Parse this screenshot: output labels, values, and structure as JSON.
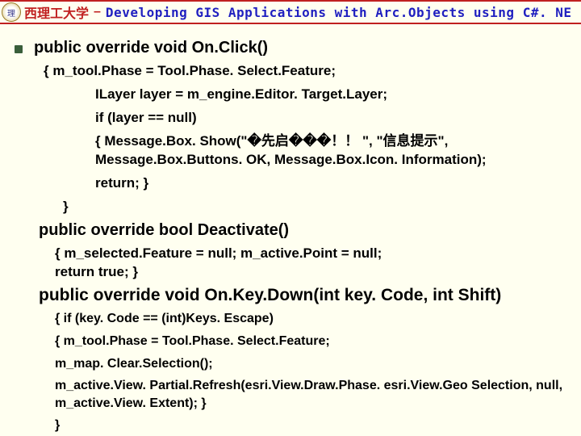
{
  "header": {
    "logo_text": "理",
    "university": "西理工大学",
    "separator": "–",
    "course_title": "Developing GIS Applications with Arc.Objects using C#. NE"
  },
  "code": {
    "method1": {
      "signature": "public override void On.Click()",
      "body_open": "{      m_tool.Phase = Tool.Phase. Select.Feature;",
      "line2": "ILayer layer = m_engine.Editor. Target.Layer;",
      "line3": "if (layer == null)",
      "line4": "{    Message.Box. Show(\"�先启���！！ \", \"信息提示\", Message.Box.Buttons. OK, Message.Box.Icon. Information);",
      "line5": "     return;     }",
      "close": "}"
    },
    "method2": {
      "signature": "public override bool Deactivate()",
      "body": "{   m_selected.Feature = null;    m_active.Point = null;\n     return true;      }"
    },
    "method3": {
      "signature": "public override void On.Key.Down(int key. Code, int Shift)",
      "line1": "{    if (key. Code == (int)Keys. Escape)",
      "line2": "          {   m_tool.Phase = Tool.Phase. Select.Feature;",
      "line3": "               m_map. Clear.Selection();",
      "line4": "               m_active.View. Partial.Refresh(esri.View.Draw.Phase. esri.View.Geo Selection, null, m_active.View. Extent);   }",
      "close": "       }"
    }
  }
}
